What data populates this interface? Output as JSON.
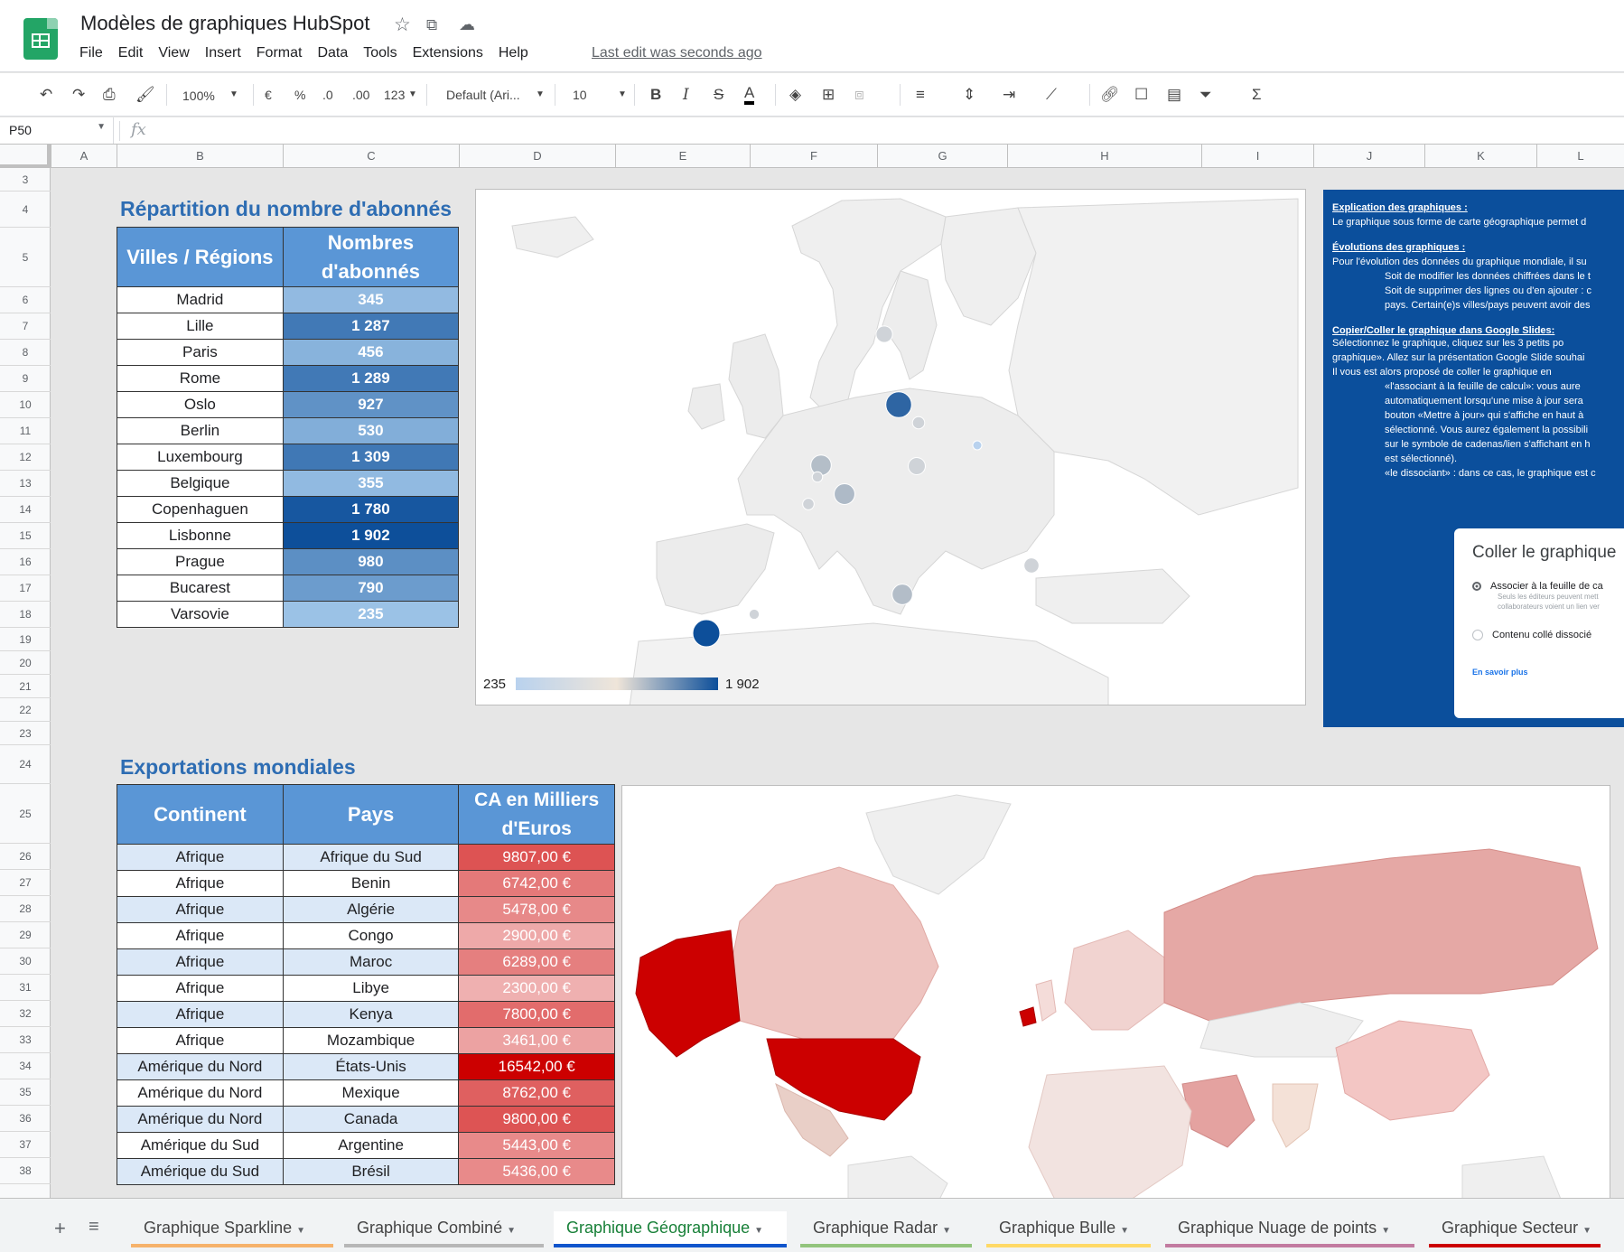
{
  "app": {
    "title": "Modèles de graphiques HubSpot",
    "menu": [
      "File",
      "Edit",
      "View",
      "Insert",
      "Format",
      "Data",
      "Tools",
      "Extensions",
      "Help"
    ],
    "last_edit": "Last edit was seconds ago"
  },
  "toolbar": {
    "zoom": "100%",
    "currency": "€",
    "percent": "%",
    "dec_decrease": ".0",
    "dec_increase": ".00",
    "number_format": "123",
    "font": "Default (Ari...",
    "font_size": "10",
    "bold": "B",
    "italic": "I",
    "strike": "S",
    "text_color": "A"
  },
  "formula_bar": {
    "cell_ref": "P50",
    "fx": "fx",
    "formula": ""
  },
  "columns": [
    "A",
    "B",
    "C",
    "D",
    "E",
    "F",
    "G",
    "H",
    "I",
    "J",
    "K",
    "L"
  ],
  "rows": [
    "3",
    "4",
    "5",
    "6",
    "7",
    "8",
    "9",
    "10",
    "11",
    "12",
    "13",
    "14",
    "15",
    "16",
    "17",
    "18",
    "19",
    "20",
    "21",
    "22",
    "23",
    "24",
    "25",
    "26",
    "27",
    "28",
    "29",
    "30",
    "31",
    "32",
    "33",
    "34",
    "35",
    "36",
    "37",
    "38"
  ],
  "subscribers": {
    "title": "Répartition du nombre d'abonnés",
    "header_city": "Villes / Régions",
    "header_count": "Nombres d'abonnés",
    "rows": [
      {
        "city": "Madrid",
        "count": "345"
      },
      {
        "city": "Lille",
        "count": "1 287"
      },
      {
        "city": "Paris",
        "count": "456"
      },
      {
        "city": "Rome",
        "count": "1 289"
      },
      {
        "city": "Oslo",
        "count": "927"
      },
      {
        "city": "Berlin",
        "count": "530"
      },
      {
        "city": "Luxembourg",
        "count": "1 309"
      },
      {
        "city": "Belgique",
        "count": "355"
      },
      {
        "city": "Copenhaguen",
        "count": "1 780"
      },
      {
        "city": "Lisbonne",
        "count": "1 902"
      },
      {
        "city": "Prague",
        "count": "980"
      },
      {
        "city": "Bucarest",
        "count": "790"
      },
      {
        "city": "Varsovie",
        "count": "235"
      }
    ]
  },
  "geo_chart": {
    "legend_min": "235",
    "legend_max": "1 902",
    "colors": {
      "low": "#b9d2ee",
      "mid": "#efe5d9",
      "high": "#0d4f9a"
    }
  },
  "info": {
    "h1": "Explication des graphiques :",
    "p1": "Le graphique sous forme de carte géographique permet d",
    "h2": "Évolutions des graphiques :",
    "p2": "Pour l'évolution des données du graphique mondiale, il su",
    "li1": "Soit de modifier les données chiffrées dans le t",
    "li2": "Soit de supprimer des lignes ou d'en ajouter : c",
    "li3": "pays. Certain(e)s villes/pays peuvent avoir des",
    "h3": "Copier/Coller le graphique dans Google Slides:",
    "p3a": "Sélectionnez le graphique, cliquez sur les 3 petits po",
    "p3b": "graphique». Allez sur la présentation Google Slide souhai",
    "p3c": "Il vous est alors proposé de coller le graphique en",
    "li4": "«l'associant à la feuille de calcul»: vous aure",
    "li5": "automatiquement lorsqu'une mise à jour sera",
    "li6": "bouton «Mettre à jour» qui s'affiche en haut à",
    "li7": "sélectionné. Vous aurez également la possibili",
    "li8": "sur le symbole de cadenas/lien s'affichant en h",
    "li9": "est sélectionné).",
    "li10": "«le dissociant» : dans ce cas, le graphique est c",
    "dialog_title": "Coller le graphique",
    "dialog_opt1": "Associer à la feuille de ca",
    "dialog_opt1_sub": "Seuls les éditeurs peuvent mett",
    "dialog_opt1_sub2": "collaborateurs voient un lien ver",
    "dialog_opt2": "Contenu collé dissocié",
    "dialog_link": "En savoir plus"
  },
  "exports": {
    "title": "Exportations mondiales",
    "header_continent": "Continent",
    "header_country": "Pays",
    "header_revenue": "CA en Milliers d'Euros",
    "rows": [
      {
        "continent": "Afrique",
        "country": "Afrique du Sud",
        "revenue": "9807,00 €"
      },
      {
        "continent": "Afrique",
        "country": "Benin",
        "revenue": "6742,00 €"
      },
      {
        "continent": "Afrique",
        "country": "Algérie",
        "revenue": "5478,00 €"
      },
      {
        "continent": "Afrique",
        "country": "Congo",
        "revenue": "2900,00 €"
      },
      {
        "continent": "Afrique",
        "country": "Maroc",
        "revenue": "6289,00 €"
      },
      {
        "continent": "Afrique",
        "country": "Libye",
        "revenue": "2300,00 €"
      },
      {
        "continent": "Afrique",
        "country": "Kenya",
        "revenue": "7800,00 €"
      },
      {
        "continent": "Afrique",
        "country": "Mozambique",
        "revenue": "3461,00 €"
      },
      {
        "continent": "Amérique du Nord",
        "country": "États-Unis",
        "revenue": "16542,00 €"
      },
      {
        "continent": "Amérique du Nord",
        "country": "Mexique",
        "revenue": "8762,00 €"
      },
      {
        "continent": "Amérique du Nord",
        "country": "Canada",
        "revenue": "9800,00 €"
      },
      {
        "continent": "Amérique du Sud",
        "country": "Argentine",
        "revenue": "5443,00 €"
      },
      {
        "continent": "Amérique du Sud",
        "country": "Brésil",
        "revenue": "5436,00 €"
      }
    ]
  },
  "sheets": {
    "tabs": [
      {
        "label": "Graphique Sparkline",
        "color": "#f6b26b"
      },
      {
        "label": "Graphique Combiné",
        "color": "#b7b7b7"
      },
      {
        "label": "Graphique Géographique",
        "color": "#1155cc",
        "active": true
      },
      {
        "label": "Graphique Radar",
        "color": "#93c47d"
      },
      {
        "label": "Graphique Bulle",
        "color": "#ffd966"
      },
      {
        "label": "Graphique Nuage de points",
        "color": "#c27ba0"
      },
      {
        "label": "Graphique Secteur",
        "color": "#cc0000"
      }
    ]
  }
}
